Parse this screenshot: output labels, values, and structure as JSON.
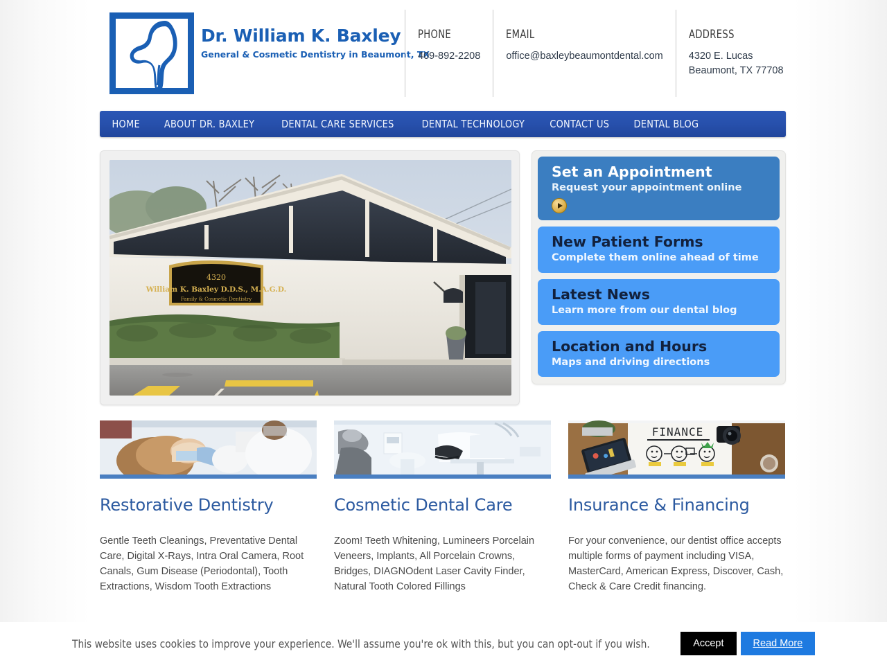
{
  "header": {
    "logo": {
      "title": "Dr. William K. Baxley",
      "subtitle": "General & Cosmetic Dentistry in Beaumont, TX",
      "icon_name": "tooth-logo-icon",
      "color": "#1a5fb4"
    },
    "contact": [
      {
        "label": "PHONE",
        "value": "409-892-2208"
      },
      {
        "label": "EMAIL",
        "value": "office@baxleybeaumontdental.com"
      },
      {
        "label": "ADDRESS",
        "value": "4320 E. Lucas\nBeaumont, TX 77708",
        "line1": "4320 E. Lucas",
        "line2": "Beaumont, TX 77708"
      }
    ]
  },
  "nav": {
    "background": "#2750ac",
    "items": [
      {
        "label": "HOME"
      },
      {
        "label": "ABOUT DR. BAXLEY"
      },
      {
        "label": "DENTAL CARE SERVICES"
      },
      {
        "label": "DENTAL TECHNOLOGY"
      },
      {
        "label": "CONTACT US"
      },
      {
        "label": "DENTAL BLOG"
      }
    ]
  },
  "hero": {
    "photo_alt": "Exterior of Dr. William K. Baxley dental office building",
    "sign_number": "4320",
    "sign_name": "William K. Baxley D.D.S., M.A.G.D.",
    "sign_tagline": "Family & Cosmetic Dentistry"
  },
  "sidebar": {
    "ctas": [
      {
        "title": "Set an Appointment",
        "subtitle": "Request your appointment online",
        "style": "primary",
        "has_play": true,
        "color": "#3b7ec1"
      },
      {
        "title": "New Patient Forms",
        "subtitle": "Complete them online ahead of time",
        "style": "secondary",
        "has_play": false,
        "color": "#4a9cf7"
      },
      {
        "title": "Latest News",
        "subtitle": "Learn more from our dental blog",
        "style": "secondary",
        "has_play": false,
        "color": "#4a9cf7"
      },
      {
        "title": "Location and Hours",
        "subtitle": "Maps and driving directions",
        "style": "secondary",
        "has_play": false,
        "color": "#4a9cf7"
      }
    ]
  },
  "services": [
    {
      "title": "Restorative Dentistry",
      "body": "Gentle Teeth Cleanings, Preventative Dental Care, Digital X-Rays, Intra Oral Camera, Root Canals, Gum Disease (Periodontal), Tooth Extractions, Wisdom Tooth Extractions",
      "thumb_alt": "Child receiving a dental cleaning",
      "accent": "#4a7fc1"
    },
    {
      "title": "Cosmetic Dental Care",
      "body": "Zoom! Teeth Whitening, Lumineers Porcelain Veneers, Implants, All Porcelain Crowns, Bridges, DIAGNOdent Laser Cavity Finder, Natural Tooth Colored Fillings",
      "thumb_alt": "Modern dental chair and operatory equipment",
      "accent": "#4a7fc1"
    },
    {
      "title": "Insurance & Financing",
      "body": "For your convenience, our dentist office accepts multiple forms of payment including VISA, MasterCard, American Express, Discover, Cash, Check & Care Credit financing.",
      "thumb_alt": "Desk with laptop and FINANCE sketch notebook",
      "thumb_text": "FINANCE",
      "accent": "#4a7fc1"
    }
  ],
  "cookie_banner": {
    "message": "This website uses cookies to improve your experience. We'll assume you're ok with this, but you can opt-out if you wish.",
    "accept_label": "Accept",
    "read_more_label": "Read More",
    "accept_color": "#000000",
    "read_more_color": "#1e7ae0"
  }
}
